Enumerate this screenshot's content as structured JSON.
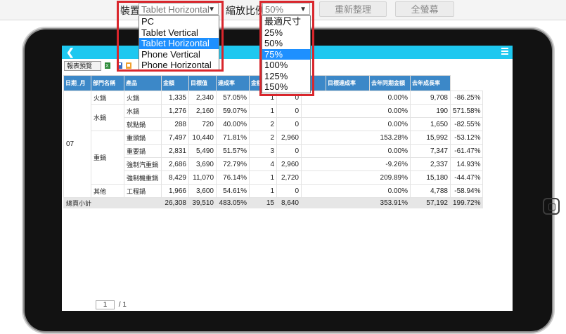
{
  "toolbar": {
    "device_label": "裝置",
    "device_value": "Tablet Horizontal",
    "zoom_label": "縮放比例",
    "zoom_value": "50%",
    "regroup_button": "重新整理",
    "fullscreen_button": "全螢幕"
  },
  "device_options": [
    "PC",
    "Tablet Vertical",
    "Tablet Horizontal",
    "Phone Vertical",
    "Phone Horizontal"
  ],
  "device_selected": "Tablet Horizontal",
  "zoom_options": [
    "最適尺寸",
    "25%",
    "50%",
    "75%",
    "100%",
    "125%",
    "150%"
  ],
  "zoom_selected": "75%",
  "report": {
    "preview_button": "報表預覽",
    "headers": [
      "日期_月",
      "部門名稱",
      "產品",
      "金額",
      "目標值",
      "達成率",
      "金額",
      "",
      "",
      "",
      "目標達成率",
      "去年同期金額",
      "去年成長率"
    ],
    "month": "07",
    "groups": [
      {
        "dept": "火鍋",
        "rows": [
          {
            "product": "火鍋",
            "amount": "1,335",
            "target": "2,340",
            "rate": "57.05%",
            "a": "1",
            "b": "0",
            "c": "0.00%",
            "last": "9,708",
            "growth": "-86.25%"
          }
        ]
      },
      {
        "dept": "水鍋",
        "rows": [
          {
            "product": "水鍋",
            "amount": "1,276",
            "target": "2,160",
            "rate": "59.07%",
            "a": "1",
            "b": "0",
            "c": "0.00%",
            "last": "190",
            "growth": "571.58%"
          },
          {
            "product": "就點鍋",
            "amount": "288",
            "target": "720",
            "rate": "40.00%",
            "a": "2",
            "b": "0",
            "c": "0.00%",
            "last": "1,650",
            "growth": "-82.55%"
          }
        ]
      },
      {
        "dept": "重鍋",
        "rows": [
          {
            "product": "重頭鍋",
            "amount": "7,497",
            "target": "10,440",
            "rate": "71.81%",
            "a": "2",
            "b": "2,960",
            "c": "153.28%",
            "last": "15,992",
            "growth": "-53.12%"
          },
          {
            "product": "重要鍋",
            "amount": "2,831",
            "target": "5,490",
            "rate": "51.57%",
            "a": "3",
            "b": "0",
            "c": "0.00%",
            "last": "7,347",
            "growth": "-61.47%"
          },
          {
            "product": "強制汽重鍋",
            "amount": "2,686",
            "target": "3,690",
            "rate": "72.79%",
            "a": "4",
            "b": "2,960",
            "c": "-9.26%",
            "last": "2,337",
            "growth": "14.93%"
          },
          {
            "product": "強制機重鍋",
            "amount": "8,429",
            "target": "11,070",
            "rate": "76.14%",
            "a": "1",
            "b": "2,720",
            "c": "209.89%",
            "last": "15,180",
            "growth": "-44.47%"
          }
        ]
      },
      {
        "dept": "其他",
        "rows": [
          {
            "product": "工程鍋",
            "amount": "1,966",
            "target": "3,600",
            "rate": "54.61%",
            "a": "1",
            "b": "0",
            "c": "0.00%",
            "last": "4,788",
            "growth": "-58.94%"
          }
        ]
      }
    ],
    "total": {
      "label": "總頁小計",
      "amount": "26,308",
      "target": "39,510",
      "rate": "483.05%",
      "a": "15",
      "b": "8,640",
      "c": "353.91%",
      "last": "57,192",
      "growth": "199.72%"
    },
    "pager": {
      "page": "1",
      "of": "/ 1"
    }
  }
}
